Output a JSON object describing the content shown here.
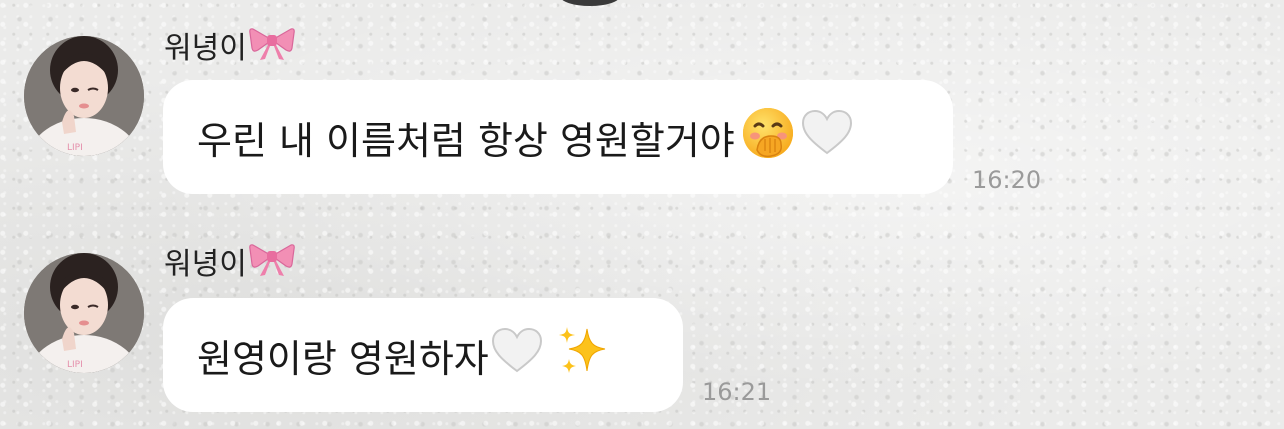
{
  "messages": [
    {
      "sender": "워녕이",
      "sender_badge_icon": "pink-ribbon-icon",
      "text": "우린 내 이름처럼 항상 영원할거야",
      "emojis": [
        "hand-over-mouth-face-icon",
        "white-heart-icon"
      ],
      "time": "16:20"
    },
    {
      "sender": "워녕이",
      "sender_badge_icon": "pink-ribbon-icon",
      "text": "원영이랑 영원하자",
      "emojis": [
        "white-heart-icon",
        "sparkles-icon"
      ],
      "time": "16:21"
    }
  ],
  "colors": {
    "bubble": "#ffffff",
    "background": "#ebebea",
    "time_text": "#9a9a9a",
    "ribbon": "#f28fb5"
  }
}
